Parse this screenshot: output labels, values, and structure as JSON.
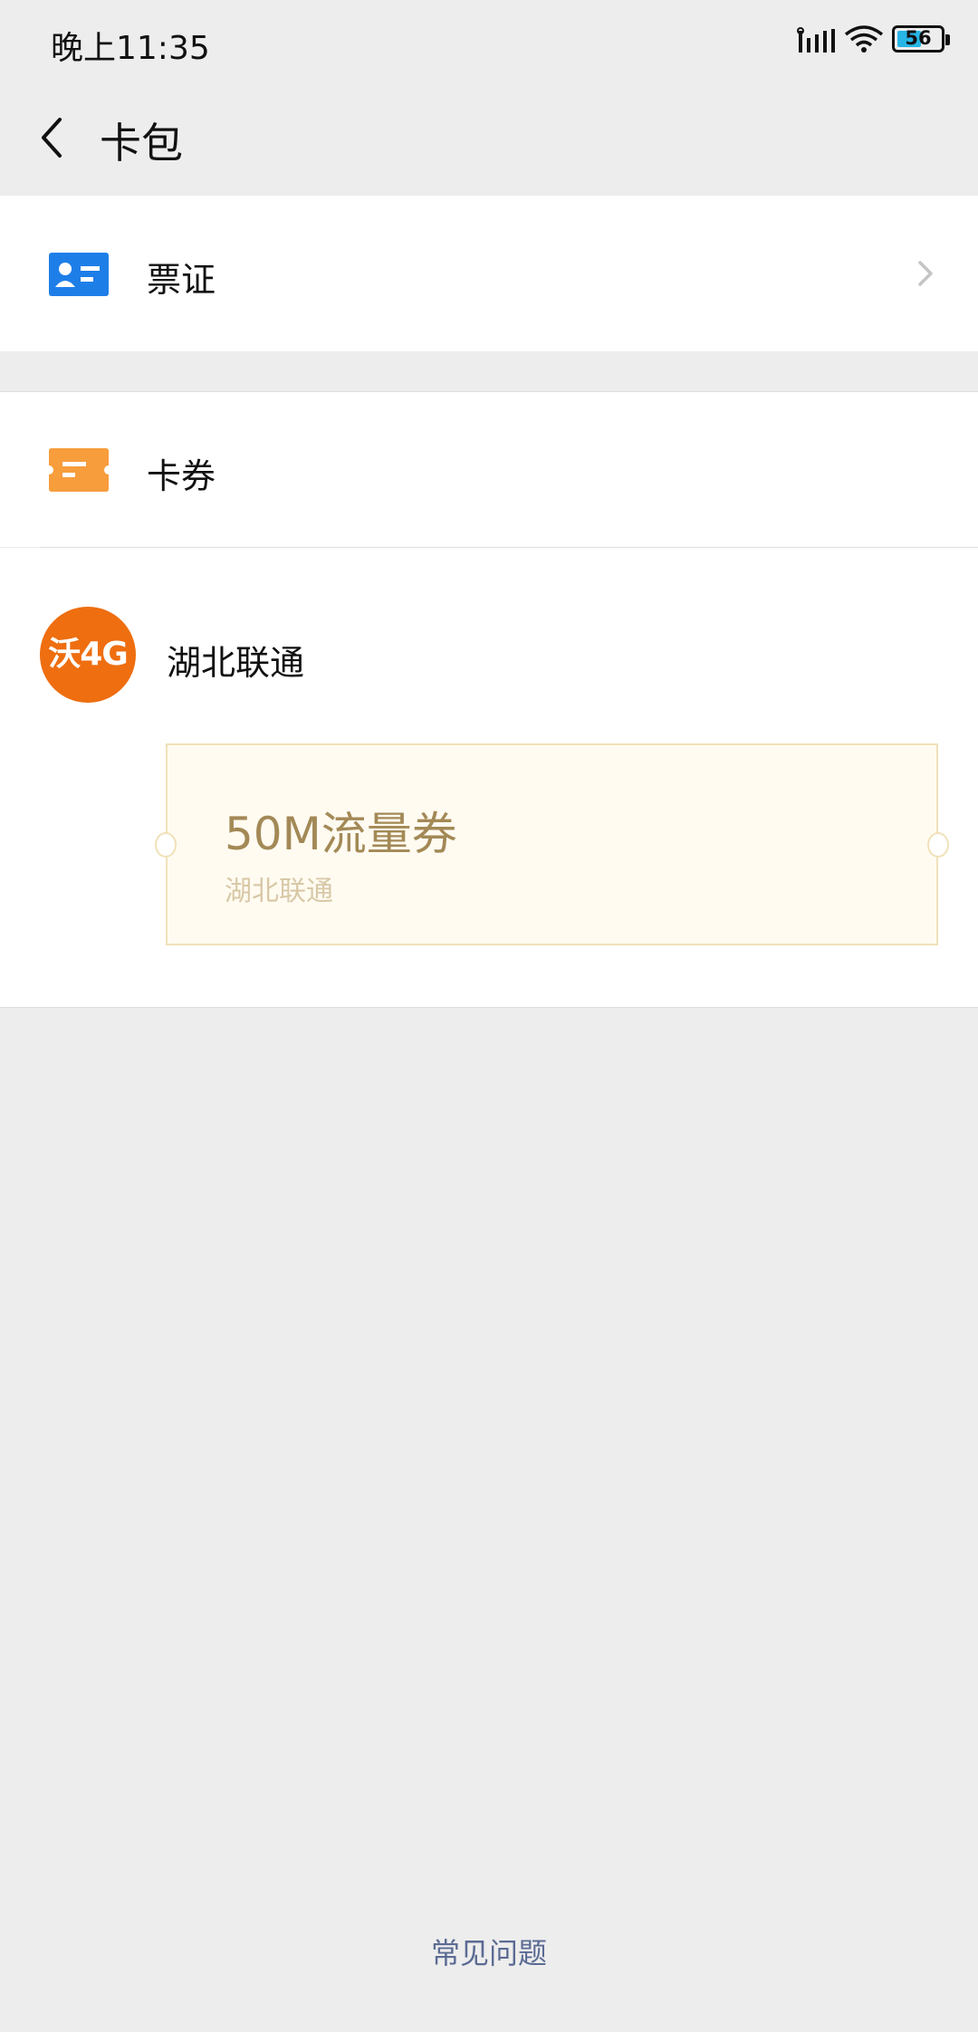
{
  "status_bar": {
    "time": "晚上11:35",
    "battery": "56",
    "battery_level": 0.56
  },
  "navbar": {
    "title": "卡包"
  },
  "sections": {
    "tickets_label": "票证",
    "coupons_label": "卡券"
  },
  "provider": {
    "logo_text": "沃4G",
    "name": "湖北联通"
  },
  "voucher": {
    "title": "50M流量券",
    "subtitle": "湖北联通"
  },
  "footer": {
    "faq_label": "常见问题"
  },
  "colors": {
    "ticket_icon": "#1e7ee8",
    "coupon_icon": "#f79d3c",
    "provider_logo": "#ee6e10",
    "voucher_title": "#a38956",
    "faq_link": "#5b6b93"
  }
}
